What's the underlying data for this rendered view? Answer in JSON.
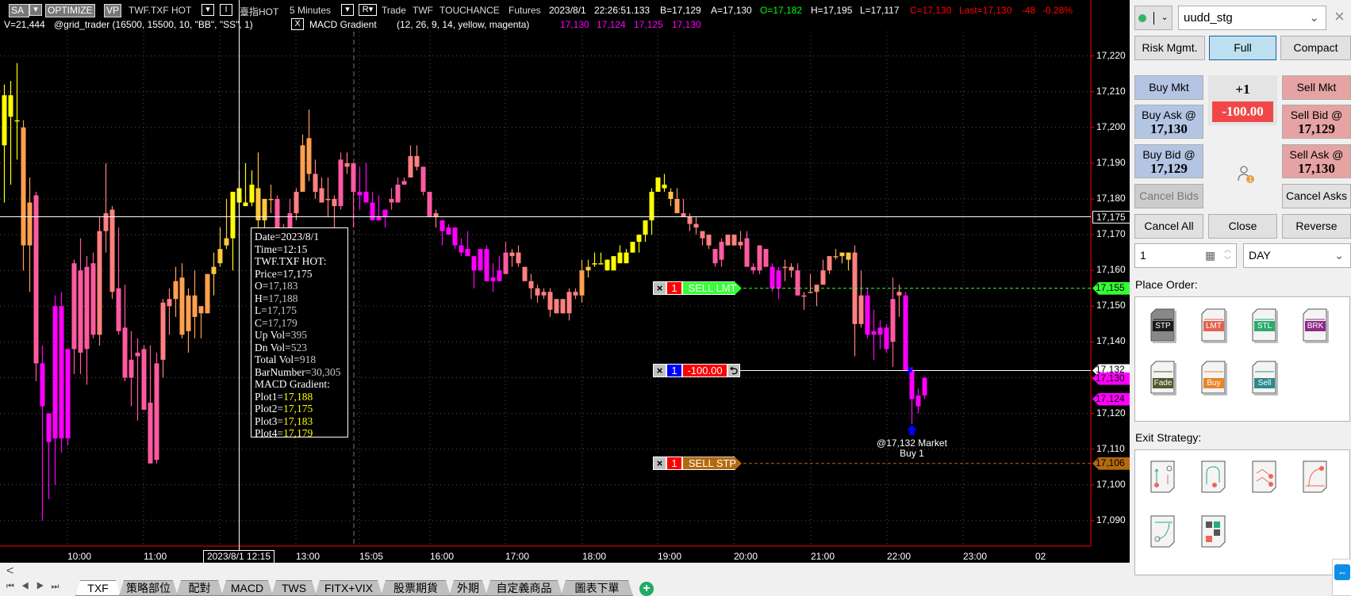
{
  "header": {
    "sa": "SA",
    "optimize": "OPTIMIZE",
    "vp": "VP",
    "symbol": "TWF.TXF HOT",
    "i_btn": "I",
    "symbol_name": "臺指HOT",
    "interval": "5 Minutes",
    "r_btn": "R",
    "trade": "Trade",
    "exchange": "TWF",
    "broker": "TOUCHANCE",
    "category": "Futures",
    "date": "2023/8/1",
    "time": "22:26:51.133",
    "bid": "B=17,129",
    "ask": "A=17,130",
    "open": "O=17,182",
    "high": "H=17,195",
    "low": "L=17,117",
    "close": "C=17,130",
    "last": "Last=17,130",
    "change": "-48",
    "change_pct": "-0.28%",
    "volume": "V=21,444",
    "strategy": "@grid_trader (16500,  15500,  10,  \"BB\",  \"SS\",  1)",
    "indicator_close": "X",
    "indicator": "MACD Gradient",
    "indicator_params": "(12,  26,  9,  14,  yellow,  magenta)",
    "indicator_values": [
      "17,130",
      "17,124",
      "17,125",
      "17,130"
    ]
  },
  "colors": {
    "up_level_palette": [
      "#ffff00",
      "#ffc83c",
      "#ffa050",
      "#ff8080",
      "#ff5aa0",
      "#ff00ff"
    ],
    "sell_lmt": "#33ff33",
    "sell_stp": "#b4690e",
    "position": "#ff0000",
    "axis": "#ff0000"
  },
  "tooltip": {
    "date": "Date=2023/8/1",
    "time": "Time=12:15",
    "symbol": "TWF.TXF HOT:",
    "price": "Price=17,175",
    "rows": [
      [
        "O=",
        "17,183"
      ],
      [
        "H=",
        "17,188"
      ],
      [
        "L=",
        "17,175"
      ],
      [
        "C=",
        "17,179"
      ],
      [
        "Up Vol=",
        "395"
      ],
      [
        "Dn Vol=",
        "523"
      ],
      [
        "Total Vol=",
        "918"
      ],
      [
        "BarNumber=",
        "30,305"
      ]
    ],
    "indicator": "MACD Gradient:",
    "plots": [
      [
        "Plot1=",
        "17,188"
      ],
      [
        "Plot2=",
        "17,175"
      ],
      [
        "Plot3=",
        "17,183"
      ],
      [
        "Plot4=",
        "17,179"
      ]
    ]
  },
  "chart_data": {
    "type": "candlestick",
    "ylim": [
      17085,
      17225
    ],
    "y_ticks": [
      "17,220",
      "17,210",
      "17,200",
      "17,190",
      "17,180",
      "17,170",
      "17,160",
      "17,150",
      "17,140",
      "17,130",
      "17,120",
      "17,110",
      "17,100",
      "17,090"
    ],
    "y_tick_values": [
      17220,
      17210,
      17200,
      17190,
      17180,
      17170,
      17160,
      17150,
      17140,
      17130,
      17120,
      17110,
      17100,
      17090
    ],
    "x_ticks": [
      "10:00",
      "11:00",
      "13:00",
      "15:05",
      "16:00",
      "17:00",
      "18:00",
      "19:00",
      "20:00",
      "21:00",
      "22:00",
      "23:00",
      "02"
    ],
    "crosshair": {
      "time_label": "2023/8/1 12:15",
      "price": 17175,
      "price_label": "17,175",
      "bar_index": 37
    },
    "ohlc": [
      [
        17195,
        17212,
        17179,
        17209
      ],
      [
        17203,
        17213,
        17184,
        17209
      ],
      [
        17202,
        17218,
        17191,
        17202
      ],
      [
        17200,
        17202,
        17160,
        17167
      ],
      [
        17179,
        17186,
        17154,
        17167
      ],
      [
        17181,
        17182,
        17129,
        17134
      ],
      [
        17134,
        17139,
        17090,
        17122
      ],
      [
        17120,
        17120,
        17096,
        17112
      ],
      [
        17113,
        17153,
        17100,
        17150
      ],
      [
        17150,
        17154,
        17109,
        17113
      ],
      [
        17113,
        17138,
        17111,
        17138
      ],
      [
        17138,
        17163,
        17131,
        17162
      ],
      [
        17160,
        17169,
        17131,
        17137
      ],
      [
        17138,
        17164,
        17128,
        17161
      ],
      [
        17142,
        17165,
        17141,
        17162
      ],
      [
        17142,
        17175,
        17139,
        17171
      ],
      [
        17171,
        17190,
        17165,
        17176
      ],
      [
        17177,
        17178,
        17152,
        17154
      ],
      [
        17155,
        17172,
        17142,
        17143
      ],
      [
        17144,
        17156,
        17129,
        17130
      ],
      [
        17130,
        17143,
        17122,
        17135
      ],
      [
        17136,
        17141,
        17118,
        17137
      ],
      [
        17138,
        17139,
        17121,
        17121
      ],
      [
        17123,
        17139,
        17106,
        17106
      ],
      [
        17107,
        17137,
        17106,
        17134
      ],
      [
        17135,
        17152,
        17130,
        17151
      ],
      [
        17150,
        17155,
        17142,
        17152
      ],
      [
        17152,
        17161,
        17147,
        17157
      ],
      [
        17158,
        17162,
        17141,
        17142
      ],
      [
        17143,
        17155,
        17137,
        17153
      ],
      [
        17153,
        17160,
        17141,
        17147
      ],
      [
        17148,
        17150,
        17141,
        17150
      ],
      [
        17148,
        17159,
        17148,
        17159
      ],
      [
        17159,
        17165,
        17153,
        17161
      ],
      [
        17162,
        17172,
        17161,
        17166
      ],
      [
        17167,
        17180,
        17166,
        17169
      ],
      [
        17169,
        17182,
        17160,
        17182
      ],
      [
        17183,
        17188,
        17175,
        17179
      ],
      [
        17179,
        17190,
        17178,
        17178
      ],
      [
        17179,
        17188,
        17178,
        17184
      ],
      [
        17183,
        17193,
        17171,
        17174
      ],
      [
        17174,
        17180,
        17172,
        17180
      ],
      [
        17180,
        17184,
        17176,
        17180
      ],
      [
        17180,
        17181,
        17166,
        17172
      ],
      [
        17172,
        17173,
        17163,
        17170
      ],
      [
        17171,
        17180,
        17163,
        17176
      ],
      [
        17176,
        17183,
        17174,
        17182
      ],
      [
        17182,
        17198,
        17182,
        17195
      ],
      [
        17187,
        17205,
        17185,
        17197
      ],
      [
        17187,
        17191,
        17180,
        17182
      ],
      [
        17183,
        17186,
        17179,
        17179
      ],
      [
        17180,
        17186,
        17175,
        17180
      ],
      [
        17180,
        17181,
        17172,
        17178
      ],
      [
        17178,
        17193,
        17177,
        17191
      ],
      [
        17190,
        17193,
        17187,
        17189
      ],
      [
        17190,
        17190,
        17172,
        17182
      ],
      [
        17182,
        17189,
        17177,
        17181
      ],
      [
        17182,
        17190,
        17179,
        17179
      ],
      [
        17179,
        17182,
        17174,
        17174
      ],
      [
        17174,
        17181,
        17174,
        17175
      ],
      [
        17175,
        17177,
        17172,
        17177
      ],
      [
        17179,
        17183,
        17177,
        17180
      ],
      [
        17179,
        17186,
        17179,
        17184
      ],
      [
        17184,
        17186,
        17184,
        17185
      ],
      [
        17186,
        17195,
        17186,
        17192
      ],
      [
        17192,
        17195,
        17188,
        17189
      ],
      [
        17189,
        17189,
        17181,
        17182
      ],
      [
        17182,
        17182,
        17175,
        17175
      ],
      [
        17175,
        17177,
        17172,
        17176
      ],
      [
        17174,
        17174,
        17167,
        17171
      ],
      [
        17172,
        17173,
        17170,
        17170
      ],
      [
        17172,
        17172,
        17166,
        17167
      ],
      [
        17167,
        17169,
        17164,
        17165
      ],
      [
        17166,
        17171,
        17164,
        17164
      ],
      [
        17164,
        17164,
        17155,
        17160
      ],
      [
        17160,
        17166,
        17160,
        17166
      ],
      [
        17166,
        17167,
        17157,
        17157
      ],
      [
        17158,
        17162,
        17154,
        17157
      ],
      [
        17157,
        17164,
        17157,
        17160
      ],
      [
        17159,
        17168,
        17159,
        17165
      ],
      [
        17164,
        17166,
        17161,
        17165
      ],
      [
        17165,
        17167,
        17161,
        17162
      ],
      [
        17161,
        17161,
        17157,
        17157
      ],
      [
        17157,
        17159,
        17152,
        17155
      ],
      [
        17155,
        17156,
        17151,
        17153
      ],
      [
        17154,
        17155,
        17152,
        17153
      ],
      [
        17154,
        17155,
        17147,
        17149
      ],
      [
        17152,
        17152,
        17148,
        17148
      ],
      [
        17152,
        17152,
        17148,
        17148
      ],
      [
        17148,
        17155,
        17146,
        17154
      ],
      [
        17154,
        17155,
        17152,
        17153
      ],
      [
        17153,
        17163,
        17151,
        17160
      ],
      [
        17160,
        17163,
        17158,
        17161
      ],
      [
        17162,
        17165,
        17161,
        17162
      ],
      [
        17162,
        17165,
        17162,
        17162
      ],
      [
        17160,
        17163,
        17160,
        17163
      ],
      [
        17160,
        17164,
        17160,
        17164
      ],
      [
        17162,
        17167,
        17162,
        17165
      ],
      [
        17162,
        17166,
        17162,
        17165
      ],
      [
        17165,
        17168,
        17165,
        17168
      ],
      [
        17168,
        17170,
        17165,
        17170
      ],
      [
        17170,
        17174,
        17168,
        17174
      ],
      [
        17174,
        17183,
        17170,
        17182
      ],
      [
        17182,
        17186,
        17182,
        17186
      ],
      [
        17184,
        17187,
        17182,
        17183
      ],
      [
        17182,
        17183,
        17178,
        17180
      ],
      [
        17180,
        17183,
        17176,
        17176
      ],
      [
        17176,
        17180,
        17175,
        17175
      ],
      [
        17175,
        17176,
        17171,
        17173
      ],
      [
        17173,
        17175,
        17170,
        17172
      ],
      [
        17171,
        17171,
        17167,
        17169
      ],
      [
        17170,
        17170,
        17166,
        17167
      ],
      [
        17166,
        17166,
        17161,
        17162
      ],
      [
        17163,
        17169,
        17161,
        17168
      ],
      [
        17167,
        17170,
        17167,
        17170
      ],
      [
        17167,
        17170,
        17167,
        17170
      ],
      [
        17168,
        17171,
        17166,
        17167
      ],
      [
        17169,
        17171,
        17161,
        17161
      ],
      [
        17161,
        17162,
        17159,
        17160
      ],
      [
        17160,
        17167,
        17159,
        17167
      ],
      [
        17166,
        17166,
        17161,
        17161
      ],
      [
        17161,
        17162,
        17154,
        17155
      ],
      [
        17160,
        17161,
        17152,
        17155
      ],
      [
        17161,
        17163,
        17157,
        17161
      ],
      [
        17161,
        17162,
        17158,
        17160
      ],
      [
        17160,
        17162,
        17153,
        17153
      ],
      [
        17153,
        17154,
        17149,
        17153
      ],
      [
        17154,
        17159,
        17154,
        17154
      ],
      [
        17154,
        17156,
        17150,
        17156
      ],
      [
        17156,
        17163,
        17156,
        17160
      ],
      [
        17160,
        17164,
        17159,
        17164
      ],
      [
        17164,
        17166,
        17163,
        17164
      ],
      [
        17164,
        17165,
        17162,
        17165
      ],
      [
        17165,
        17165,
        17160,
        17163
      ],
      [
        17165,
        17167,
        17136,
        17145
      ],
      [
        17145,
        17160,
        17144,
        17153
      ],
      [
        17153,
        17155,
        17141,
        17142
      ],
      [
        17142,
        17149,
        17135,
        17143
      ],
      [
        17142,
        17146,
        17138,
        17144
      ],
      [
        17144,
        17145,
        17137,
        17138
      ],
      [
        17140,
        17158,
        17133,
        17152
      ],
      [
        17153,
        17156,
        17147,
        17154
      ],
      [
        17153,
        17154,
        17132,
        17132
      ],
      [
        17132,
        17133,
        17117,
        17124
      ],
      [
        17122,
        17127,
        17120,
        17125
      ],
      [
        17125,
        17130,
        17124,
        17130
      ]
    ],
    "gradient_level": [
      0,
      0,
      0,
      2,
      2,
      4,
      5,
      5,
      5,
      5,
      5,
      4,
      4,
      4,
      4,
      3,
      3,
      3,
      4,
      4,
      4,
      4,
      4,
      4,
      4,
      3,
      3,
      2,
      2,
      2,
      2,
      2,
      2,
      1,
      1,
      1,
      0,
      0,
      0,
      0,
      1,
      1,
      2,
      4,
      4,
      4,
      3,
      2,
      2,
      3,
      3,
      3,
      3,
      4,
      3,
      4,
      5,
      5,
      5,
      5,
      5,
      4,
      4,
      4,
      3,
      3,
      4,
      4,
      3,
      5,
      5,
      5,
      5,
      5,
      5,
      5,
      5,
      5,
      5,
      4,
      3,
      3,
      3,
      3,
      3,
      3,
      3,
      3,
      3,
      3,
      3,
      2,
      1,
      0,
      0,
      0,
      0,
      0,
      0,
      0,
      0,
      0,
      0,
      0,
      0,
      1,
      2,
      3,
      3,
      3,
      3,
      3,
      4,
      4,
      3,
      3,
      3,
      4,
      4,
      4,
      4,
      5,
      5,
      3,
      3,
      4,
      3,
      3,
      3,
      3,
      3,
      2,
      1,
      1,
      3,
      3,
      5,
      5,
      5,
      5,
      4,
      3,
      5,
      5,
      5,
      5
    ],
    "orders": {
      "sell_lmt": {
        "price": 17155,
        "qty": "1",
        "label": "SELL LMT",
        "axis_label": "17,155"
      },
      "position": {
        "price": 17132,
        "qty": "1",
        "pnl": "-100.00",
        "axis_label": "17,132"
      },
      "sell_stp": {
        "price": 17106,
        "qty": "1",
        "label": "SELL STP",
        "axis_label": "17,106"
      },
      "close": "×"
    },
    "price_markers": [
      {
        "price": 17130,
        "label": "17,130"
      },
      {
        "price": 17124,
        "label": "17,124"
      }
    ],
    "fill": {
      "bar_index": 143,
      "line1": "@17,132 Market",
      "line2": "Buy 1"
    }
  },
  "panel": {
    "strategy": "uudd_stg",
    "close": "×",
    "views": [
      "Risk Mgmt.",
      "Full",
      "Compact"
    ],
    "buy_mkt": "Buy Mkt",
    "sell_mkt": "Sell Mkt",
    "position": "+1",
    "pnl": "-100.00",
    "buy_ask": "Buy Ask @",
    "buy_ask_price": "17,130",
    "sell_bid": "Sell Bid @",
    "sell_bid_price": "17,129",
    "buy_bid": "Buy Bid @",
    "buy_bid_price": "17,129",
    "sell_ask": "Sell Ask @",
    "sell_ask_price": "17,130",
    "cancel_bids": "Cancel Bids",
    "cancel_asks": "Cancel Asks",
    "cancel_all": "Cancel All",
    "close_btn": "Close",
    "reverse": "Reverse",
    "qty": "1",
    "tif": "DAY",
    "badge": "1",
    "place_order": "Place Order:",
    "order_types": [
      {
        "label": "STP",
        "color": "#1a1a1a"
      },
      {
        "label": "LMT",
        "color": "#e0644e"
      },
      {
        "label": "STL",
        "color": "#2eaa6e"
      },
      {
        "label": "BRK",
        "color": "#8e2a8a"
      },
      {
        "label": "Fade",
        "color": "#4e5a2e"
      },
      {
        "label": "Buy",
        "color": "#e8842a"
      },
      {
        "label": "Sell",
        "color": "#2e8a8a"
      }
    ],
    "exit_strategy": "Exit Strategy:"
  },
  "tabs": {
    "items": [
      "TXF",
      "策略部位",
      "配對",
      "MACD",
      "TWS",
      "FITX+VIX",
      "股票期貨",
      "外期",
      "自定義商品",
      "圖表下單"
    ],
    "active": 0,
    "add": "+",
    "scroll_left": "<"
  }
}
